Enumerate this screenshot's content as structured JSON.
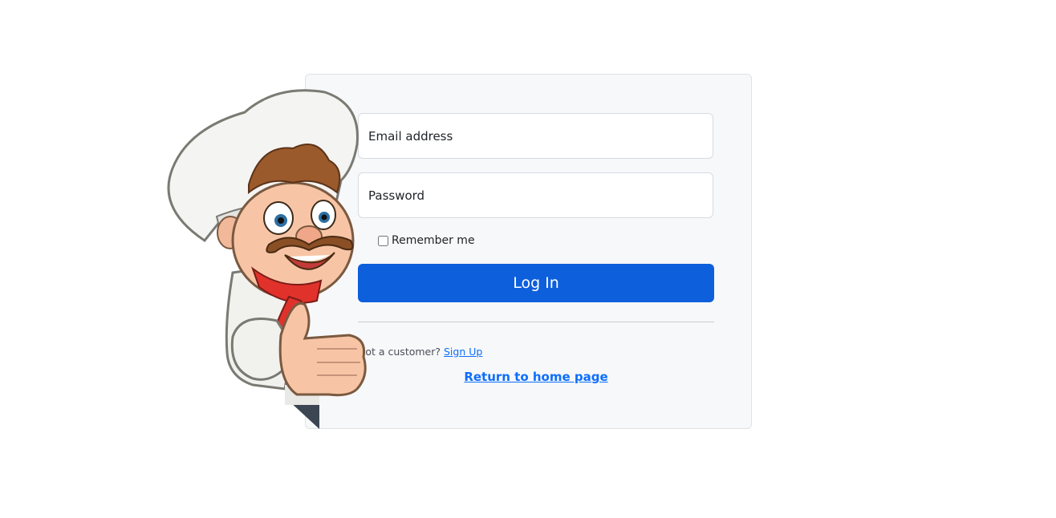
{
  "login_form": {
    "email_placeholder": "Email address",
    "password_placeholder": "Password",
    "remember_label": "Remember me",
    "remember_checked": false,
    "login_button_label": "Log In",
    "signup_prompt": "Not a customer?",
    "signup_link_label": "Sign Up",
    "home_link_label": "Return to home page"
  },
  "colors": {
    "primary_button": "#0d5fdc",
    "link": "#0d6efd",
    "card_background": "#f7f8fa"
  }
}
